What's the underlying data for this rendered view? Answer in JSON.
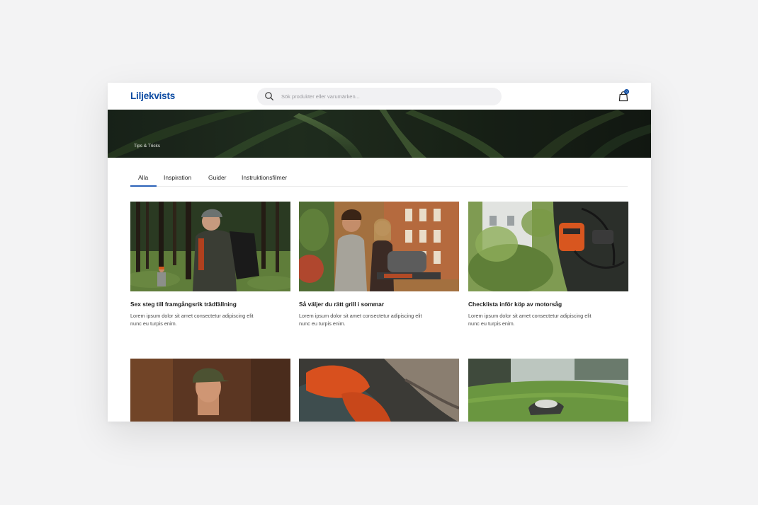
{
  "header": {
    "logo_text": "Liljekvists",
    "search_placeholder": "Sök produkter eller varumärken...",
    "cart_count": "0"
  },
  "hero": {
    "label": "Tips & Tricks"
  },
  "tabs": [
    {
      "label": "Alla",
      "active": true
    },
    {
      "label": "Inspiration",
      "active": false
    },
    {
      "label": "Guider",
      "active": false
    },
    {
      "label": "Instruktionsfilmer",
      "active": false
    }
  ],
  "articles": [
    {
      "title": "Sex steg till framgångsrik trädfällning",
      "excerpt": "Lorem ipsum dolor sit amet consectetur adipiscing elit nunc eu turpis enim."
    },
    {
      "title": "Så väljer du rätt grill i sommar",
      "excerpt": "Lorem ipsum dolor sit amet consectetur adipiscing elit nunc eu turpis enim."
    },
    {
      "title": "Checklista inför köp av motorsåg",
      "excerpt": "Lorem ipsum dolor sit amet consectetur adipiscing elit nunc eu turpis enim."
    },
    {
      "title": "",
      "excerpt": ""
    },
    {
      "title": "",
      "excerpt": ""
    },
    {
      "title": "",
      "excerpt": ""
    }
  ],
  "colors": {
    "brand": "#0b4aa2",
    "tab_underline": "#2b62b8",
    "page_background": "#f3f3f4"
  },
  "icons": {
    "search": "search-icon",
    "cart": "shopping-bag-icon"
  }
}
